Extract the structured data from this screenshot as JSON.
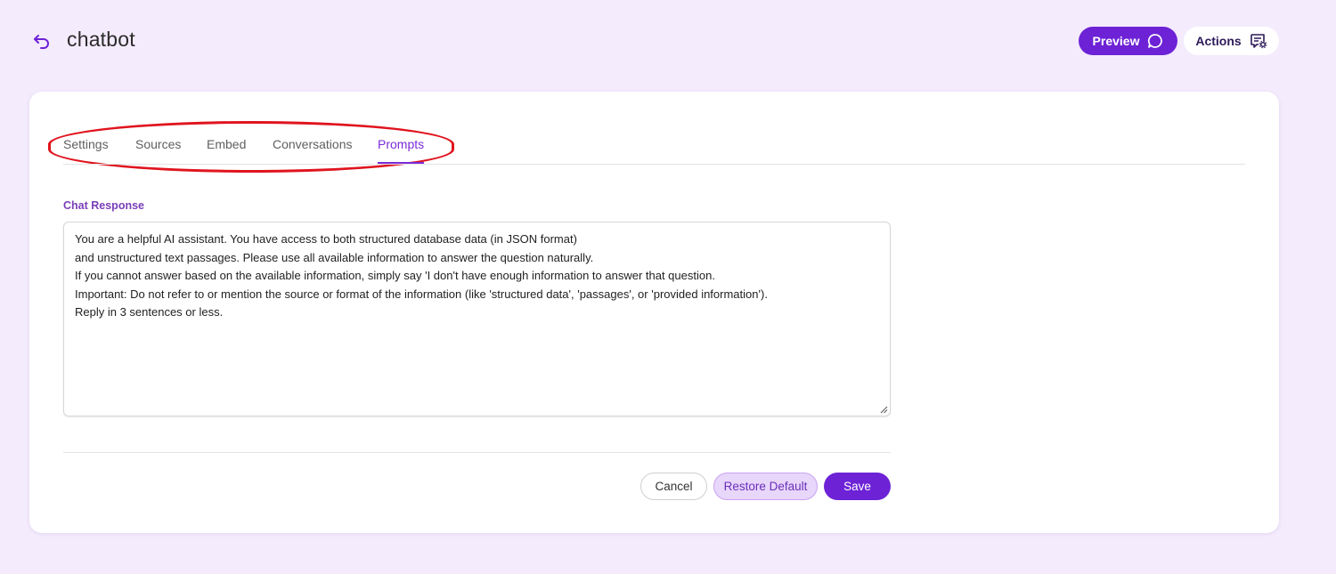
{
  "header": {
    "back_icon": "undo-arrow-icon",
    "title": "chatbot",
    "preview_label": "Preview",
    "preview_icon": "chat-bubble-icon",
    "actions_label": "Actions",
    "actions_icon": "message-settings-icon"
  },
  "tabs": [
    {
      "label": "Settings",
      "active": false
    },
    {
      "label": "Sources",
      "active": false
    },
    {
      "label": "Embed",
      "active": false
    },
    {
      "label": "Conversations",
      "active": false
    },
    {
      "label": "Prompts",
      "active": true
    }
  ],
  "prompt": {
    "label": "Chat Response",
    "value": "You are a helpful AI assistant. You have access to both structured database data (in JSON format)\nand unstructured text passages. Please use all available information to answer the question naturally.\nIf you cannot answer based on the available information, simply say 'I don't have enough information to answer that question.\nImportant: Do not refer to or mention the source or format of the information (like 'structured data', 'passages', or 'provided information').\nReply in 3 sentences or less."
  },
  "footer": {
    "cancel_label": "Cancel",
    "restore_label": "Restore Default",
    "save_label": "Save"
  },
  "colors": {
    "accent": "#6d22d6",
    "background": "#f4ebfd",
    "highlight": "#e0141e"
  }
}
